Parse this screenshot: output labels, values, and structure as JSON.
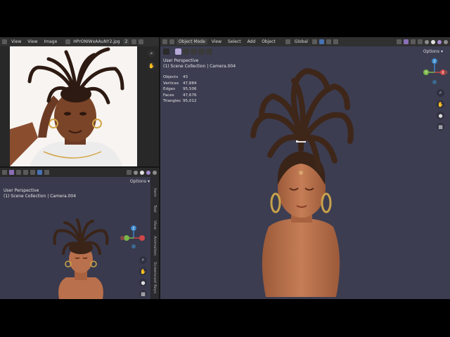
{
  "image_editor": {
    "menu": [
      "View",
      "View",
      "Image"
    ],
    "image_name": "HPrONIWxAAuNY2.jpg",
    "users_count": "2"
  },
  "main_viewport": {
    "mode": "Object Mode",
    "menu": [
      "View",
      "Select",
      "Add",
      "Object"
    ],
    "transform": "Global",
    "options": "Options",
    "perspective": "User Perspective",
    "collection": "(1) Scene Collection | Camera.004",
    "stats": [
      {
        "label": "Objects",
        "value": "43"
      },
      {
        "label": "Vertices",
        "value": "47,884"
      },
      {
        "label": "Edges",
        "value": "95,506"
      },
      {
        "label": "Faces",
        "value": "47,676"
      },
      {
        "label": "Triangles",
        "value": "95,012"
      }
    ]
  },
  "secondary_viewport": {
    "options": "Options",
    "perspective": "User Perspective",
    "collection": "(1) Scene Collection | Camera.004",
    "side_tabs": [
      "Item",
      "Tool",
      "View",
      "Animation",
      "Screencast Keys"
    ]
  },
  "gizmo": {
    "z": "Z",
    "y": "Y",
    "x": "X"
  },
  "colors": {
    "viewport_bg": "#3c3d51",
    "header_bg": "#303030",
    "accent": "#4772b3",
    "skin": "#b9704c",
    "hair": "#3a2418",
    "gold": "#c9a24a"
  }
}
